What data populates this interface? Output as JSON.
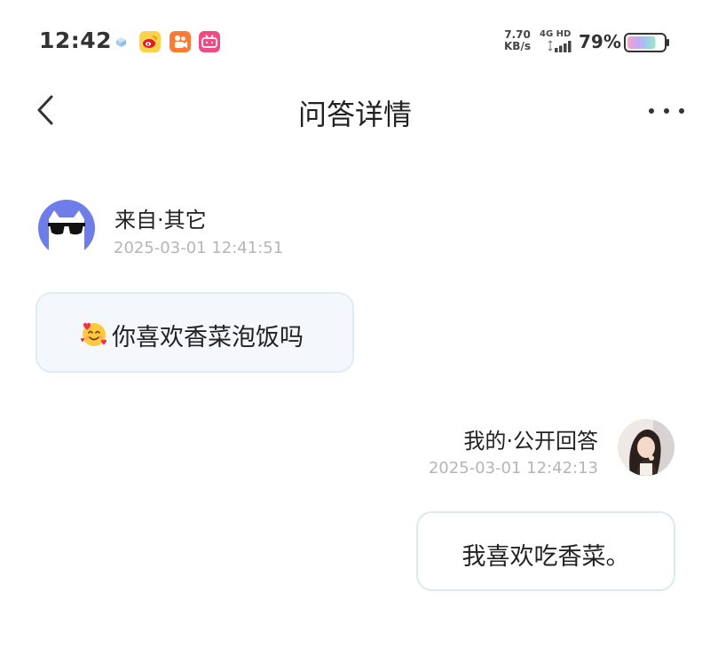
{
  "status_bar": {
    "time": "12:42",
    "net_speed_value": "7.70",
    "net_speed_unit": "KB/s",
    "network_type": "4G HD",
    "battery_percent": "79%",
    "battery_level": 0.79,
    "notification_apps": [
      "weibo-icon",
      "kuaishou-icon",
      "bilibili-icon"
    ]
  },
  "header": {
    "title": "问答详情",
    "back_icon": "chevron-left-icon",
    "more_icon": "more-dots-icon"
  },
  "question": {
    "sender": "来自·其它",
    "timestamp": "2025-03-01 12:41:51",
    "emoji": "smiling-face-with-hearts",
    "text": "你喜欢香菜泡饭吗"
  },
  "answer": {
    "sender": "我的·公开回答",
    "timestamp": "2025-03-01 12:42:13",
    "text": "我喜欢吃香菜。"
  },
  "colors": {
    "asker_avatar_bg": "#6f7de8",
    "question_bubble_bg": "#f4f8fd",
    "question_bubble_border": "#e1ebf5",
    "answer_bubble_border": "#dde9ec",
    "timestamp_text": "#b5b5b5"
  }
}
